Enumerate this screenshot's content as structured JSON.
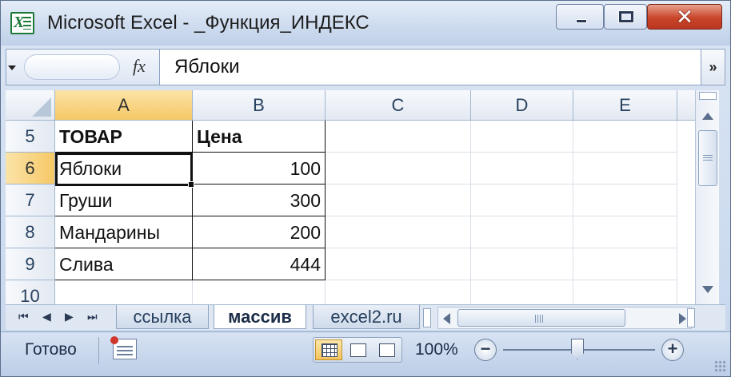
{
  "window": {
    "title": "Microsoft Excel - _Функция_ИНДЕКС",
    "controls": {
      "minimize_glyph": "▬",
      "maximize_glyph": "□",
      "close_glyph": "✕"
    }
  },
  "formula_bar": {
    "fx_label": "fx",
    "value": "Яблоки",
    "expand_glyph": "»"
  },
  "sheet": {
    "columns": [
      "A",
      "B",
      "C",
      "D",
      "E"
    ],
    "active_column": "A",
    "rows": [
      {
        "num": "5",
        "a": "ТОВАР",
        "b": "Цена"
      },
      {
        "num": "6",
        "a": "Яблоки",
        "b": "100"
      },
      {
        "num": "7",
        "a": "Груши",
        "b": "300"
      },
      {
        "num": "8",
        "a": "Мандарины",
        "b": "200"
      },
      {
        "num": "9",
        "a": "Слива",
        "b": "444"
      },
      {
        "num": "10",
        "a": "",
        "b": ""
      }
    ],
    "active_row": "6",
    "selected_cell": "A6"
  },
  "tabs": {
    "nav": [
      "⏮",
      "◀",
      "▶",
      "⏭"
    ],
    "items": [
      {
        "label": "ссылка",
        "active": false
      },
      {
        "label": "массив",
        "active": true
      },
      {
        "label": "excel2.ru",
        "active": false
      }
    ]
  },
  "status": {
    "ready": "Готово",
    "zoom": "100%",
    "zoom_level_percent": 100,
    "view": "normal"
  },
  "colors": {
    "active_header": "#f6c866",
    "header_text": "#27415f",
    "title_bar": "#cfdcef",
    "close_button": "#c9452a"
  }
}
